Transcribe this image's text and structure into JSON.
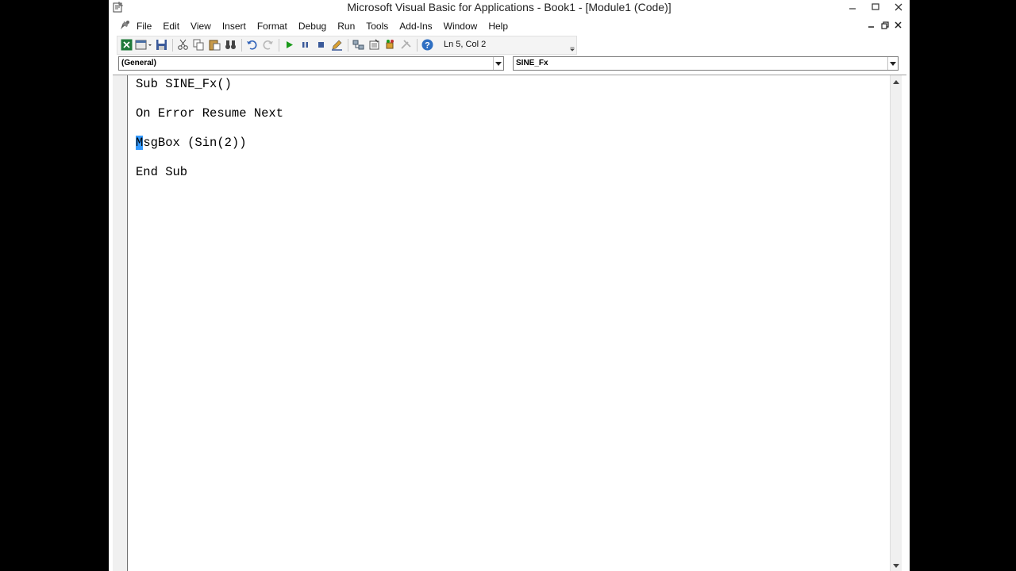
{
  "window": {
    "title": "Microsoft Visual Basic for Applications - Book1 - [Module1 (Code)]"
  },
  "menu": {
    "items": [
      {
        "label": "File"
      },
      {
        "label": "Edit"
      },
      {
        "label": "View"
      },
      {
        "label": "Insert"
      },
      {
        "label": "Format"
      },
      {
        "label": "Debug"
      },
      {
        "label": "Run"
      },
      {
        "label": "Tools"
      },
      {
        "label": "Add-Ins"
      },
      {
        "label": "Window"
      },
      {
        "label": "Help"
      }
    ]
  },
  "toolbar": {
    "status": "Ln 5, Col 2"
  },
  "combos": {
    "object": "(General)",
    "procedure": "SINE_Fx"
  },
  "code": {
    "line1": "Sub SINE_Fx()",
    "line2": "On Error Resume Next",
    "line3_cursor": "M",
    "line3_rest": "sgBox (Sin(2))",
    "line4": "End Sub"
  },
  "colors": {
    "selection": "#3399ff",
    "excel_green": "#1f7a3a",
    "run_green": "#1a9a1a",
    "help_blue": "#2f6fc2"
  }
}
